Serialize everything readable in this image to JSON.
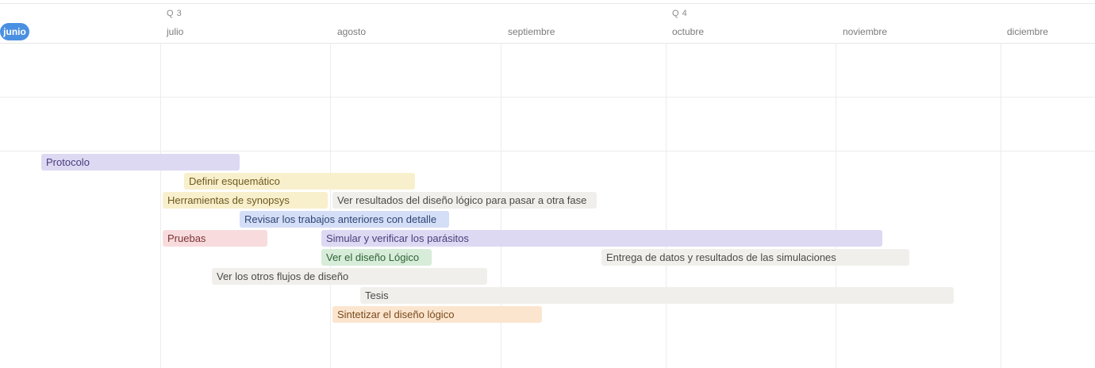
{
  "timeline": {
    "current_month": "junio",
    "quarters": [
      "Q 3",
      "Q 4"
    ],
    "months": [
      "julio",
      "agosto",
      "septiembre",
      "octubre",
      "noviembre",
      "diciembre"
    ],
    "tasks": [
      {
        "label": "Protocolo",
        "color": "#ddd9f3"
      },
      {
        "label": "Definir esquemático",
        "color": "#f8efcc"
      },
      {
        "label": "Herramientas de synopsys",
        "color": "#f8efcc"
      },
      {
        "label": "Ver resultados del diseño lógico para pasar a otra fase",
        "color": "#f0efeb"
      },
      {
        "label": "Revisar los trabajos anteriores con detalle",
        "color": "#d4def6"
      },
      {
        "label": "Pruebas",
        "color": "#f8dcdd"
      },
      {
        "label": "Simular y verificar los parásitos",
        "color": "#ddd9f3"
      },
      {
        "label": "Ver el diseño Lógico",
        "color": "#d7ecd9"
      },
      {
        "label": "Entrega de datos y resultados de las simulaciones",
        "color": "#f0efeb"
      },
      {
        "label": "Ver los otros flujos de diseño",
        "color": "#f0efeb"
      },
      {
        "label": "Tesis",
        "color": "#f0efeb"
      },
      {
        "label": "Sintetizar el diseño lógico",
        "color": "#fbe5cf"
      }
    ]
  }
}
